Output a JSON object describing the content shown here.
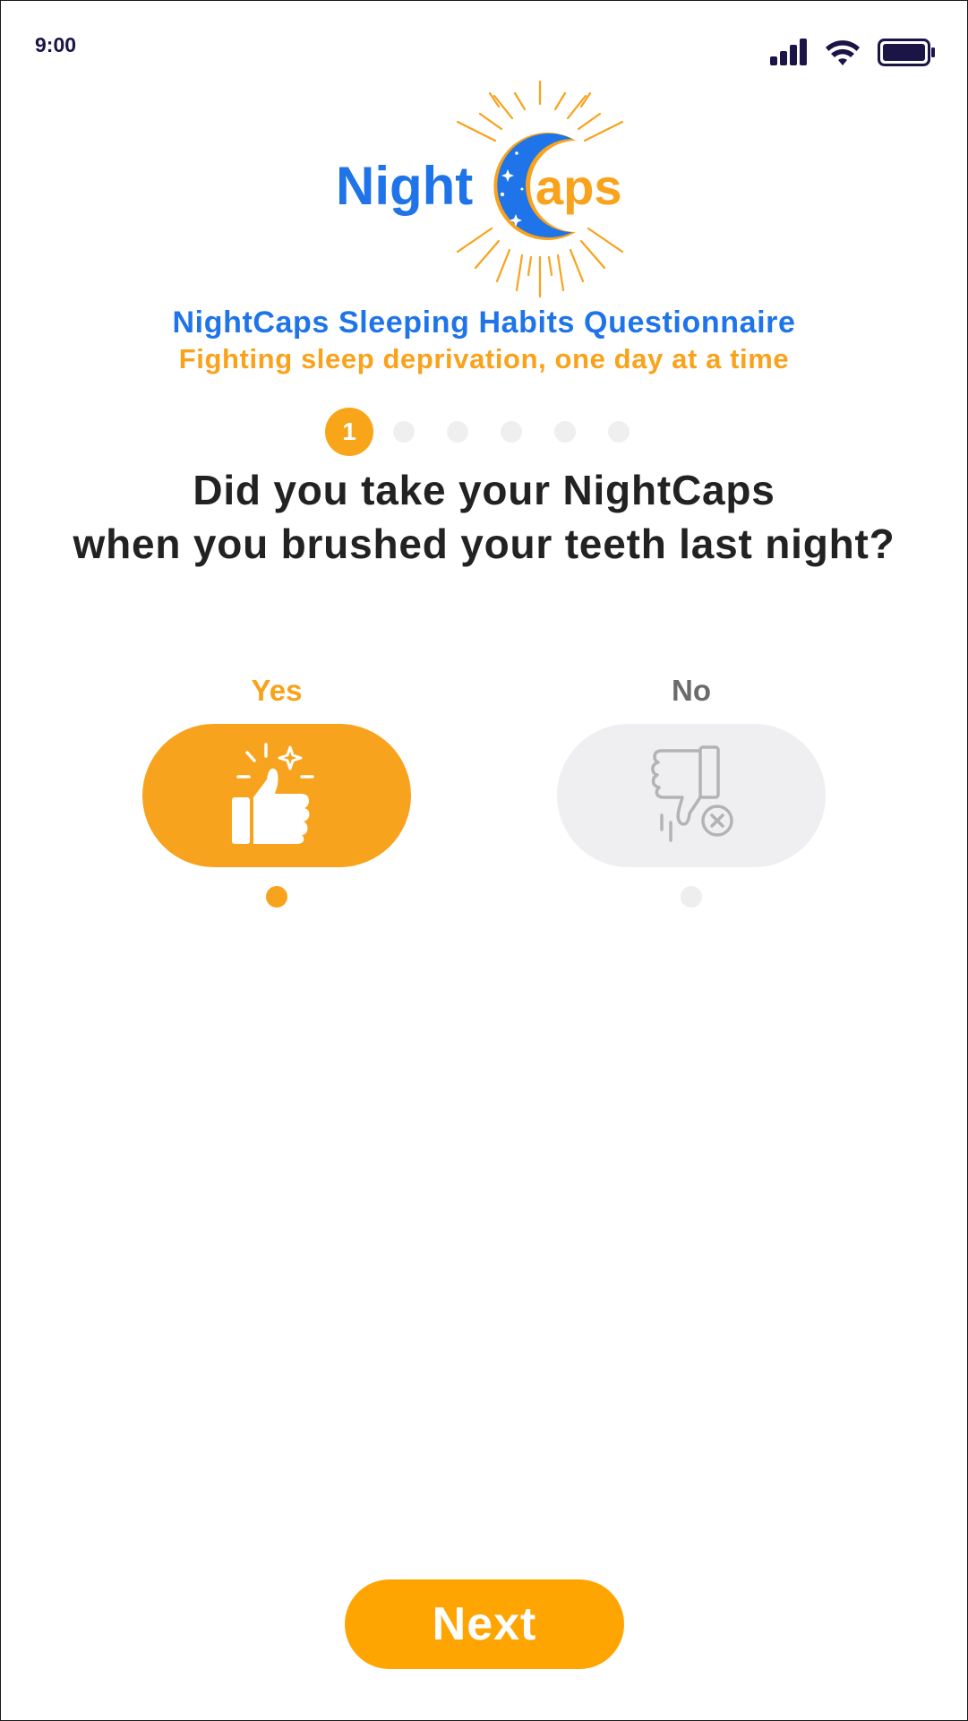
{
  "status_bar": {
    "time": "9:00",
    "icons": [
      "signal-icon",
      "wifi-icon",
      "battery-icon"
    ]
  },
  "logo": {
    "word_left": "Night",
    "word_right": "aps",
    "colors": {
      "blue": "#1e74e8",
      "orange": "#f9a21b"
    }
  },
  "header": {
    "title": "NightCaps Sleeping Habits Questionnaire",
    "subtitle": "Fighting sleep deprivation, one day at a time"
  },
  "progress": {
    "current_step": "1",
    "total_steps": 6
  },
  "question": {
    "line1": "Did you take your NightCaps",
    "line2": "when you brushed your teeth last night?"
  },
  "options": [
    {
      "label": "Yes",
      "icon": "thumbs-up-icon",
      "selected": true
    },
    {
      "label": "No",
      "icon": "thumbs-down-icon",
      "selected": false
    }
  ],
  "actions": {
    "next_label": "Next"
  },
  "colors": {
    "accent": "#f8a31d",
    "brand_blue": "#1e74e8",
    "inactive": "#efeff1",
    "text_dark": "#222222"
  }
}
